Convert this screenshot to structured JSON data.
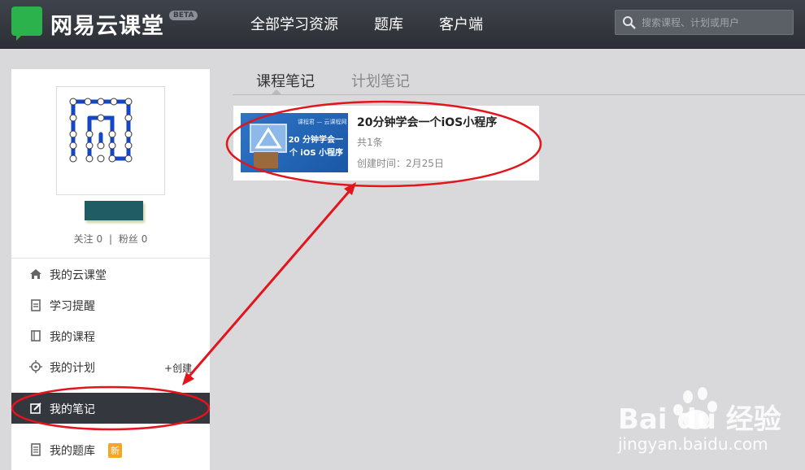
{
  "app": {
    "logo_text": "网易云课堂",
    "beta": "BETA"
  },
  "nav": {
    "items": [
      {
        "label": "全部学习资源"
      },
      {
        "label": "题库"
      },
      {
        "label": "客户端"
      }
    ]
  },
  "search": {
    "placeholder": "搜索课程、计划或用户",
    "value": ""
  },
  "profile": {
    "follow_label": "关注",
    "follow_count": "0",
    "fans_label": "粉丝",
    "fans_count": "0",
    "separator": "|"
  },
  "sidebar": {
    "items": [
      {
        "label": "我的云课堂",
        "icon": "home-icon"
      },
      {
        "label": "学习提醒",
        "icon": "clipboard-icon"
      },
      {
        "label": "我的课程",
        "icon": "book-icon"
      },
      {
        "label": "我的计划",
        "icon": "target-icon",
        "extra": "+创建"
      },
      {
        "label": "我的笔记",
        "icon": "edit-icon",
        "active": true
      },
      {
        "label": "我的题库",
        "icon": "list-icon",
        "badge": "新"
      }
    ]
  },
  "tabs": [
    {
      "label": "课程笔记",
      "active": true
    },
    {
      "label": "计划笔记",
      "active": false
    }
  ],
  "notes": [
    {
      "title": "20分钟学会一个iOS小程序",
      "count": "共1条",
      "created": "创建时间：2月25日",
      "thumb_caption": "课程君 — 云课程网",
      "thumb_line1": "20 分钟学会一",
      "thumb_line2": "个 iOS 小程序"
    }
  ],
  "watermark": {
    "brand": "Bai du 经验",
    "url": "jingyan.baidu.com"
  },
  "colors": {
    "topbar": "#34373e",
    "active_menu": "#34373e",
    "accent_green": "#2bb24c",
    "annotation_red": "#e3141b",
    "badge": "#f5a623"
  }
}
